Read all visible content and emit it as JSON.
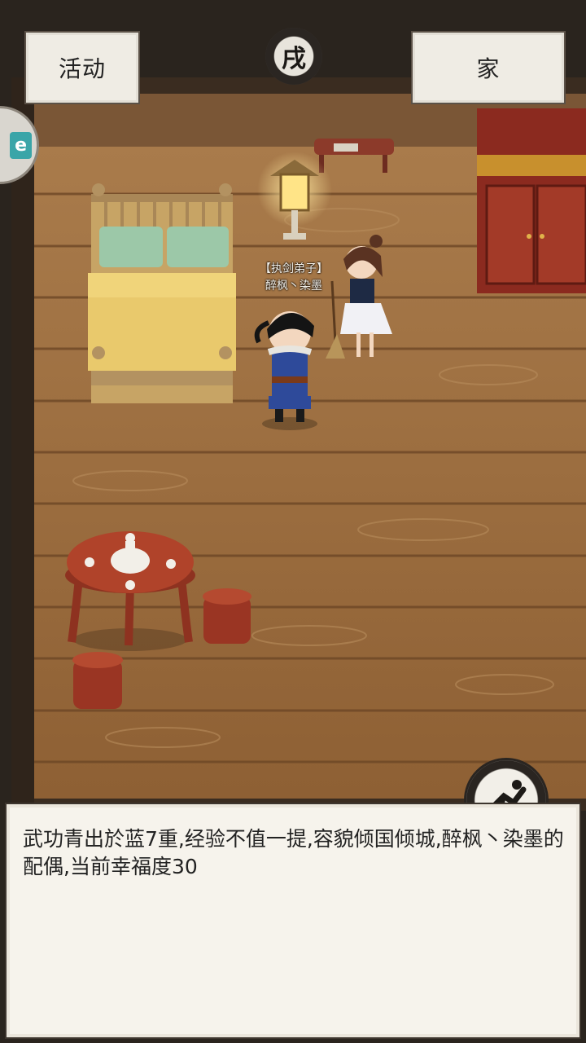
{
  "header": {
    "left_button_label": "活动",
    "right_button_label": "家",
    "time_glyph": "戌"
  },
  "side_tab": {
    "label": "e"
  },
  "character": {
    "title": "【执剑弟子】",
    "name": "醉枫丶染墨"
  },
  "dialog": {
    "text": "武功青出於蓝7重,经验不值一提,容貌倾国倾城,醉枫丶染墨的配偶,当前幸福度30"
  },
  "icons": {
    "time": "time-seal-icon",
    "run": "run-icon"
  },
  "colors": {
    "floor": "#9a6a3c",
    "wall": "#6f4a2a",
    "dialog_bg": "#f6f3ec",
    "button_bg": "#efece4"
  }
}
